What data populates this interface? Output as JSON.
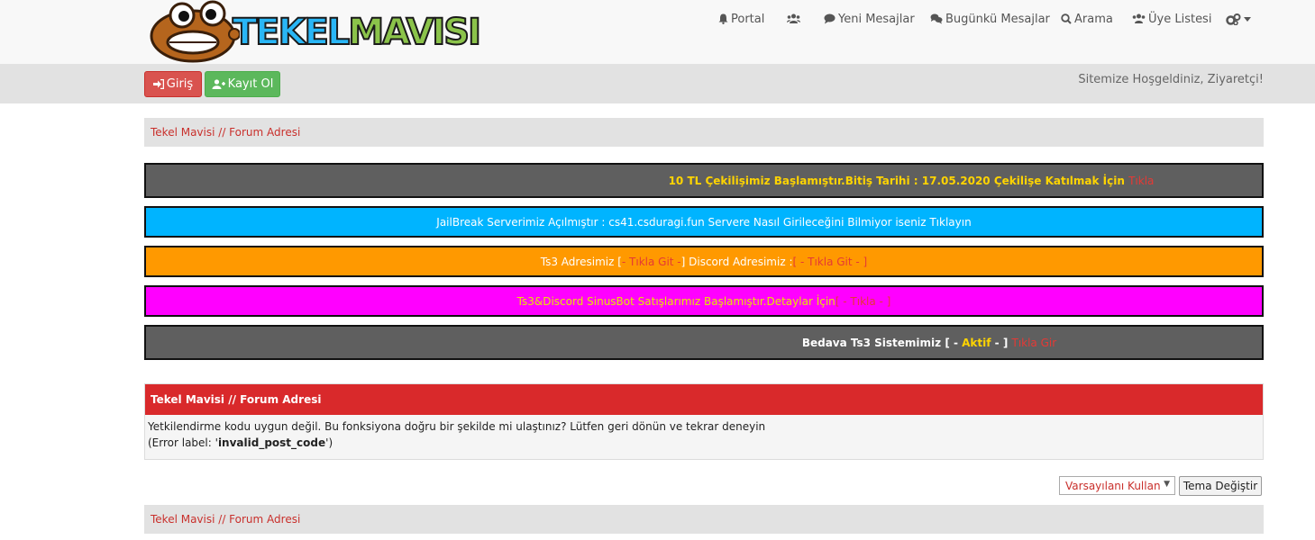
{
  "logo": {
    "part1": "TEKEL",
    "part2": "MAVISI"
  },
  "nav": {
    "portal": "Portal",
    "new_posts": "Yeni Mesajlar",
    "today_posts": "Bugünkü Mesajlar",
    "search": "Arama",
    "member_list": "Üye Listesi"
  },
  "auth": {
    "login": "Giriş",
    "register": "Kayıt Ol"
  },
  "welcome": "Sitemize Hoşgeldiniz, Ziyaretçi!",
  "breadcrumb": "Tekel Mavisi // Forum Adresi",
  "announcements": {
    "a1": {
      "text": "10 TL Çekilişimiz Başlamıştır.Bitiş Tarihi : 17.05.2020 Çekilişe Katılmak İçin ",
      "link": "Tıkla"
    },
    "a2": {
      "text": "JailBreak Serverimiz Açılmıştır : cs41.csduragi.fun Servere Nasıl Girileceğini Bilmiyor iseniz Tıklayın"
    },
    "a3": {
      "t1": "Ts3 Adresimiz [",
      "l1": " - Tıkla Git - ",
      "t2": "] Discord Adresimiz : ",
      "l2": "[ - Tıkla Git - ]"
    },
    "a4": {
      "text": "Ts3&Discord SinusBot Satışlarımız Başlamıştır.Detaylar İçin ",
      "link": "[ - Tıkla - ]"
    },
    "a5": {
      "t1": "Bedava Ts3 Sistemimiz [ - ",
      "status": "Aktif",
      "t2": " - ] ",
      "link": "Tıkla Gir"
    }
  },
  "error": {
    "title": "Tekel Mavisi // Forum Adresi",
    "message": "Yetkilendirme kodu uygun değil. Bu fonksiyona doğru bir şekilde mi ulaştınız? Lütfen geri dönün ve tekrar deneyin",
    "label_prefix": "(Error label: '",
    "label_code": "invalid_post_code",
    "label_suffix": "')"
  },
  "theme": {
    "selected": "Varsayılanı Kullan",
    "button": "Tema Değiştir"
  },
  "colors": {
    "ann_dark": "#5f5f5f",
    "ann_blue": "#00b4ff",
    "ann_orange": "#ff9900",
    "ann_magenta": "#ff00ff",
    "error_red": "#d9292b"
  }
}
